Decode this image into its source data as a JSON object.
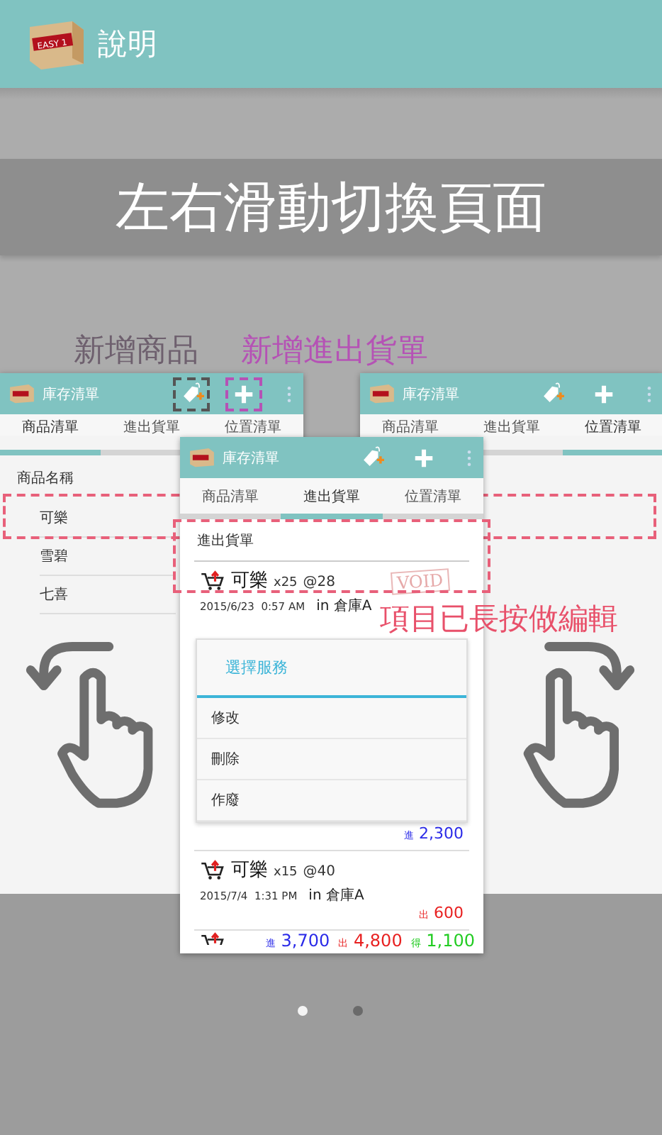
{
  "app_bar": {
    "title": "說明",
    "logo_text": "EASY 1"
  },
  "banner": "左右滑動切換頁面",
  "callouts": [
    {
      "text": "新增商品",
      "color": "#6e606e"
    },
    {
      "text": "新增進出貨單",
      "color": "#b552b5"
    }
  ],
  "screens": [
    {
      "kind": "products",
      "title": "庫存清單",
      "tabs": [
        {
          "label": "商品清單",
          "selected": true
        },
        {
          "label": "進出貨單",
          "selected": false
        },
        {
          "label": "位置清單",
          "selected": false
        }
      ],
      "header": "商品名稱",
      "items": [
        "可樂",
        "雪碧",
        "七喜"
      ]
    },
    {
      "kind": "locations",
      "title": "庫存清單",
      "tabs": [
        {
          "label": "商品清單",
          "selected": false
        },
        {
          "label": "進出貨單",
          "selected": false
        },
        {
          "label": "位置清單",
          "selected": true
        }
      ]
    },
    {
      "kind": "transactions",
      "title": "庫存清單",
      "tabs": [
        {
          "label": "商品清單",
          "selected": false
        },
        {
          "label": "進出貨單",
          "selected": true
        },
        {
          "label": "位置清單",
          "selected": false
        }
      ],
      "header": "進出貨單",
      "entries": [
        {
          "name": "可樂",
          "qty": "x25",
          "price": "@28",
          "date": "2015/6/23  0:57 AM",
          "location": "in 倉庫A",
          "stamp": "VOID"
        },
        {
          "name": "可樂",
          "qty": "x15",
          "price": "@40",
          "date": "2015/7/4  1:31 PM",
          "location": "in 倉庫A"
        }
      ],
      "amounts": [
        {
          "label": "進",
          "value": "2,300",
          "kind": "in"
        },
        {
          "label": "出",
          "value": "600",
          "kind": "out"
        }
      ],
      "dialog": {
        "title": "選擇服務",
        "options": [
          "修改",
          "刪除",
          "作廢"
        ]
      },
      "totals": [
        {
          "label": "進",
          "value": "3,700",
          "kind": "in"
        },
        {
          "label": "出",
          "value": "4,800",
          "kind": "out"
        },
        {
          "label": "得",
          "value": "1,100",
          "kind": "net"
        }
      ]
    }
  ],
  "hint": "項目已長按做編輯",
  "pages": [
    {
      "selected": true
    },
    {
      "selected": false
    }
  ]
}
